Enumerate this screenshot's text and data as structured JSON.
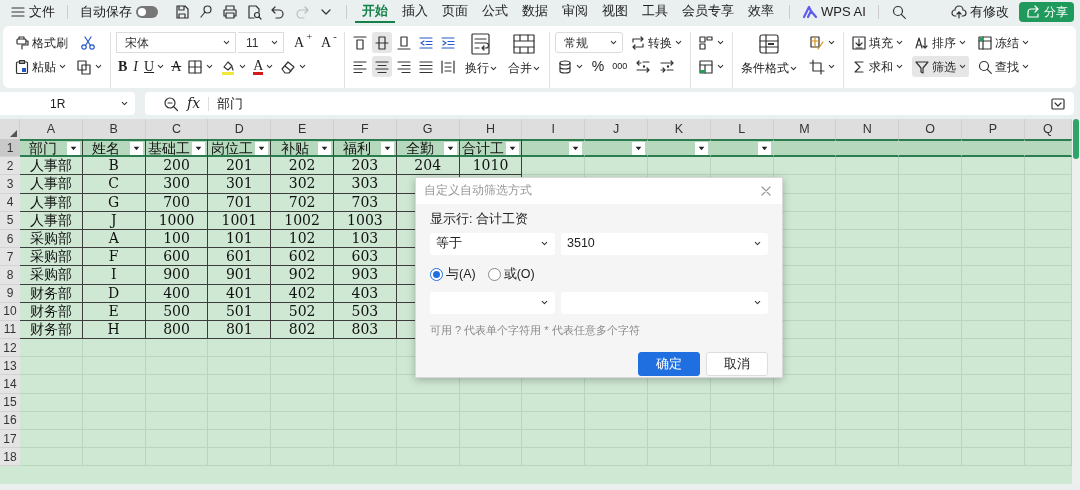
{
  "menu": {
    "file": "文件",
    "autosave": {
      "label": "自动保存",
      "on": false
    },
    "tabs": [
      {
        "label": "开始",
        "selected": true
      },
      {
        "label": "插入",
        "selected": false
      },
      {
        "label": "页面",
        "selected": false
      },
      {
        "label": "公式",
        "selected": false
      },
      {
        "label": "数据",
        "selected": false
      },
      {
        "label": "审阅",
        "selected": false
      },
      {
        "label": "视图",
        "selected": false
      },
      {
        "label": "工具",
        "selected": false
      },
      {
        "label": "会员专享",
        "selected": false
      },
      {
        "label": "效率",
        "selected": false
      }
    ],
    "ai": "WPS AI",
    "changes": "有修改",
    "share": "分享"
  },
  "ribbon": {
    "format_painter": "格式刷",
    "paste": "粘贴",
    "font": "宋体",
    "size": "11",
    "grow": "A$^{+}$",
    "shrink": "A$^{-}$",
    "bold": "B",
    "italic": "I",
    "underline": "U",
    "strike": "A",
    "font_color": "A",
    "valign_buttons": [
      {
        "selected": false
      },
      {
        "selected": true
      },
      {
        "selected": false
      }
    ],
    "halign_buttons": [
      {
        "selected": false
      },
      {
        "selected": true
      },
      {
        "selected": false
      },
      {
        "selected": false
      }
    ],
    "wrap": "换行",
    "merge": "合并",
    "number_format": "常规",
    "convert": "转换",
    "percent": "%",
    "thousands": "000",
    "conditional_format": "条件格式",
    "fill": "填充",
    "sort": "排序",
    "freeze": "冻结",
    "sum": "求和",
    "filter": {
      "label": "筛选",
      "active": true
    },
    "find": "查找"
  },
  "formula_bar": {
    "name_box": "1R",
    "fx": "fx",
    "content": "部门"
  },
  "sheet": {
    "columns": [
      "A",
      "B",
      "C",
      "D",
      "E",
      "F",
      "G",
      "H",
      "I",
      "J",
      "K",
      "L",
      "M",
      "N",
      "O",
      "P",
      "Q"
    ],
    "row_numbers": [
      "1",
      "2",
      "3",
      "4",
      "5",
      "6",
      "7",
      "8",
      "9",
      "10",
      "11",
      "12",
      "13",
      "14",
      "15",
      "16",
      "17",
      "18"
    ],
    "header": [
      {
        "text": "部门",
        "filter": true
      },
      {
        "text": "姓名",
        "filter": true
      },
      {
        "text": "基础工",
        "filter": true
      },
      {
        "text": "岗位工",
        "filter": true
      },
      {
        "text": "补贴",
        "filter": true
      },
      {
        "text": "福利",
        "filter": true
      },
      {
        "text": "全勤",
        "filter": true
      },
      {
        "text": "合计工",
        "filter": true
      },
      {
        "filter": true
      },
      {
        "filter": true
      },
      {
        "filter": true
      },
      {
        "filter": true
      }
    ],
    "rows": [
      [
        "人事部",
        "B",
        "200",
        "201",
        "202",
        "203",
        "204",
        "1010"
      ],
      [
        "人事部",
        "C",
        "300",
        "301",
        "302",
        "303"
      ],
      [
        "人事部",
        "G",
        "700",
        "701",
        "702",
        "703"
      ],
      [
        "人事部",
        "J",
        "1000",
        "1001",
        "1002",
        "1003"
      ],
      [
        "采购部",
        "A",
        "100",
        "101",
        "102",
        "103"
      ],
      [
        "采购部",
        "F",
        "600",
        "601",
        "602",
        "603"
      ],
      [
        "采购部",
        "I",
        "900",
        "901",
        "902",
        "903"
      ],
      [
        "财务部",
        "D",
        "400",
        "401",
        "402",
        "403"
      ],
      [
        "财务部",
        "E",
        "500",
        "501",
        "502",
        "503"
      ],
      [
        "财务部",
        "H",
        "800",
        "801",
        "802",
        "803"
      ]
    ]
  },
  "dialog": {
    "title": "自定义自动筛选方式",
    "label": "显示行: 合计工资",
    "conditions": [
      {
        "operator": "等于",
        "value": "3510"
      }
    ],
    "logic": [
      {
        "label": "与(A)",
        "selected": true
      },
      {
        "label": "或(O)",
        "selected": false
      }
    ],
    "hint": "可用 ? 代表单个字符用 * 代表任意多个字符",
    "buttons": [
      {
        "label": "确定",
        "kind": "primary"
      },
      {
        "label": "取消",
        "kind": "secondary"
      }
    ]
  }
}
